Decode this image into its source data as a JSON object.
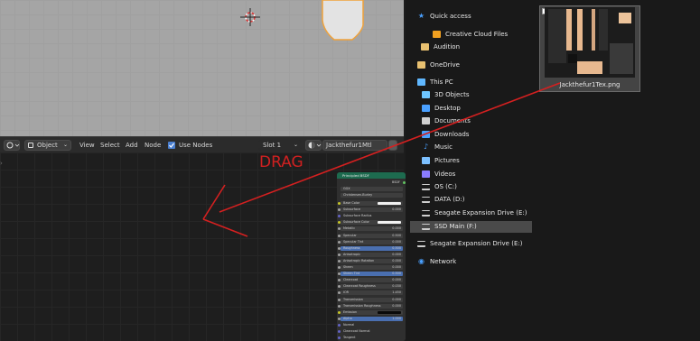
{
  "nodebar": {
    "mode": "Object",
    "menu": [
      "View",
      "Select",
      "Add",
      "Node"
    ],
    "use_nodes_label": "Use Nodes",
    "slot": "Slot 1",
    "material": "Jackthefur1Mtl"
  },
  "annotation": {
    "drag_label": "DRAG",
    "color": "#d42020"
  },
  "bsdf_node": {
    "title": "Principled BSDF",
    "output": "BSDF",
    "distribution": "GGX",
    "subsurface_method": "Christensen-Burley",
    "rows": [
      {
        "label": "Base Color",
        "value": ""
      },
      {
        "label": "Subsurface",
        "value": "0.000"
      },
      {
        "label": "Subsurface Radius",
        "value": ""
      },
      {
        "label": "Subsurface Color",
        "value": ""
      },
      {
        "label": "Metallic",
        "value": "0.000"
      },
      {
        "label": "Specular",
        "value": "0.500"
      },
      {
        "label": "Specular Tint",
        "value": "0.000"
      },
      {
        "label": "Roughness",
        "value": "0.500"
      },
      {
        "label": "Anisotropic",
        "value": "0.000"
      },
      {
        "label": "Anisotropic Rotation",
        "value": "0.000"
      },
      {
        "label": "Sheen",
        "value": "0.000"
      },
      {
        "label": "Sheen Tint",
        "value": "0.500"
      },
      {
        "label": "Clearcoat",
        "value": "0.000"
      },
      {
        "label": "Clearcoat Roughness",
        "value": "0.030"
      },
      {
        "label": "IOR",
        "value": "1.450"
      },
      {
        "label": "Transmission",
        "value": "0.000"
      },
      {
        "label": "Transmission Roughness",
        "value": "0.000"
      },
      {
        "label": "Emission",
        "value": ""
      },
      {
        "label": "Alpha",
        "value": "1.000"
      },
      {
        "label": "Normal",
        "value": ""
      },
      {
        "label": "Clearcoat Normal",
        "value": ""
      },
      {
        "label": "Tangent",
        "value": ""
      }
    ]
  },
  "explorer": {
    "items": [
      {
        "label": "Quick access",
        "icon": "star-icon"
      },
      {
        "label": "Creative Cloud Files",
        "icon": "cc-folder-icon"
      },
      {
        "label": "Audition",
        "icon": "folder-icon"
      },
      {
        "label": "OneDrive",
        "icon": "folder-icon"
      },
      {
        "label": "This PC",
        "icon": "pc-icon"
      },
      {
        "label": "3D Objects",
        "icon": "cube-icon"
      },
      {
        "label": "Desktop",
        "icon": "desktop-icon"
      },
      {
        "label": "Documents",
        "icon": "documents-icon"
      },
      {
        "label": "Downloads",
        "icon": "download-icon"
      },
      {
        "label": "Music",
        "icon": "music-icon"
      },
      {
        "label": "Pictures",
        "icon": "pictures-icon"
      },
      {
        "label": "Videos",
        "icon": "videos-icon"
      },
      {
        "label": "OS (C:)",
        "icon": "drive-icon"
      },
      {
        "label": "DATA (D:)",
        "icon": "drive-icon"
      },
      {
        "label": "Seagate Expansion Drive (E:)",
        "icon": "drive-icon"
      },
      {
        "label": "SSD Main (F:)",
        "icon": "drive-icon"
      },
      {
        "label": "Seagate Expansion Drive (E:)",
        "icon": "drive-icon"
      },
      {
        "label": "Network",
        "icon": "network-icon"
      }
    ]
  },
  "file": {
    "name": "Jackthefur1Tex.png"
  }
}
